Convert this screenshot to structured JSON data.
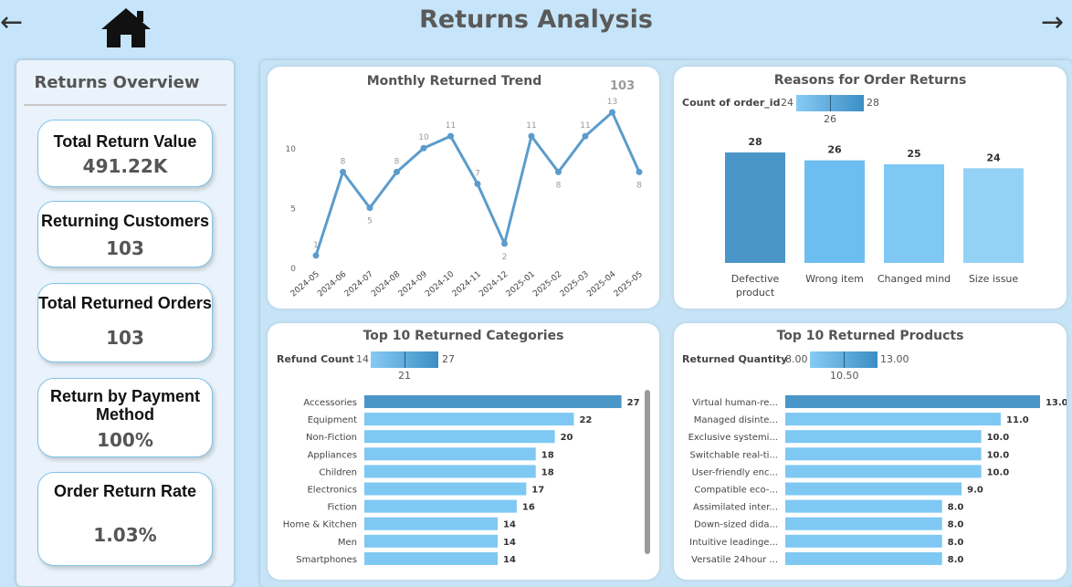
{
  "header": {
    "title": "Returns Analysis",
    "back_icon": "arrow-left-icon",
    "home_icon": "home-icon",
    "forward_icon": "arrow-right-icon"
  },
  "sidebar": {
    "title": "Returns Overview",
    "kpis": [
      {
        "label": "Total Return Value",
        "value": "491.22K"
      },
      {
        "label": "Returning Customers",
        "value": "103"
      },
      {
        "label": "Total Returned Orders",
        "value": "103"
      },
      {
        "label": "Return by Payment Method",
        "value": "100%"
      },
      {
        "label": "Order Return Rate",
        "value": "1.03%"
      }
    ]
  },
  "colors": {
    "background": "#c6e5fa",
    "bar_light": "#7ec8f3",
    "bar_highlight": "#4a96c8",
    "line": "#5b9ccc"
  },
  "chart_data": [
    {
      "type": "line",
      "title": "Monthly Returned Trend",
      "total_label": "103",
      "x": [
        "2024-05",
        "2024-06",
        "2024-07",
        "2024-08",
        "2024-09",
        "2024-10",
        "2024-11",
        "2024-12",
        "2025-01",
        "2025-02",
        "2025-03",
        "2025-04",
        "2025-05"
      ],
      "values": [
        1,
        8,
        5,
        8,
        10,
        11,
        7,
        2,
        11,
        8,
        11,
        13,
        8
      ],
      "ylim": [
        0,
        13
      ],
      "yticks": [
        0,
        5,
        10
      ],
      "grid": false
    },
    {
      "type": "bar",
      "title": "Reasons for Order Returns",
      "legend": {
        "label": "Count of order_id",
        "min": "24",
        "max": "28",
        "mid": "26"
      },
      "categories": [
        "Defective product",
        "Wrong item",
        "Changed mind",
        "Size issue"
      ],
      "values": [
        28,
        26,
        25,
        24
      ]
    },
    {
      "type": "bar",
      "orientation": "horizontal",
      "title": "Top 10 Returned Categories",
      "legend": {
        "label": "Refund Count",
        "min": "14",
        "max": "27",
        "mid": "21"
      },
      "categories": [
        "Accessories",
        "Equipment",
        "Non-Fiction",
        "Appliances",
        "Children",
        "Electronics",
        "Fiction",
        "Home & Kitchen",
        "Men",
        "Smartphones"
      ],
      "values": [
        27,
        22,
        20,
        18,
        18,
        17,
        16,
        14,
        14,
        14
      ],
      "value_labels": [
        "27",
        "22",
        "20",
        "18",
        "18",
        "17",
        "16",
        "14",
        "14",
        "14"
      ]
    },
    {
      "type": "bar",
      "orientation": "horizontal",
      "title": "Top 10 Returned Products",
      "legend": {
        "label": "Returned Quantity",
        "min": "8.00",
        "max": "13.00",
        "mid": "10.50"
      },
      "categories": [
        "Virtual human-re...",
        "Managed disinte...",
        "Exclusive systemi...",
        "Switchable real-ti...",
        "User-friendly enc...",
        "Compatible eco-...",
        "Assimilated inter...",
        "Down-sized dida...",
        "Intuitive leadinge...",
        "Versatile 24hour ..."
      ],
      "values": [
        13,
        11,
        10,
        10,
        10,
        9,
        8,
        8,
        8,
        8
      ],
      "value_labels": [
        "13.0",
        "11.0",
        "10.0",
        "10.0",
        "10.0",
        "9.0",
        "8.0",
        "8.0",
        "8.0",
        "8.0"
      ]
    }
  ]
}
